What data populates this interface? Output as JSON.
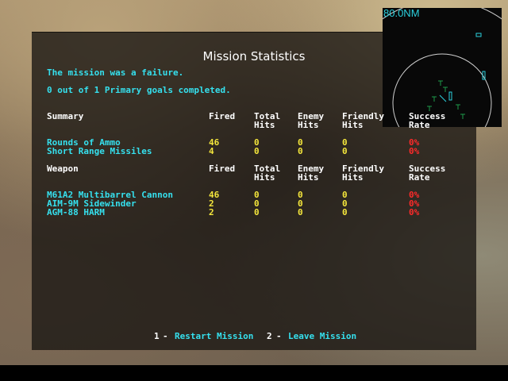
{
  "title": "Mission Statistics",
  "status_line": "The mission was a failure.",
  "goals_line": "0 out of 1 Primary goals completed.",
  "radar": {
    "range_label": "80.0NM"
  },
  "columns": {
    "fired": "Fired",
    "total_hits_1": "Total",
    "total_hits_2": "Hits",
    "enemy_hits_1": "Enemy",
    "enemy_hits_2": "Hits",
    "friendly_hits_1": "Friendly",
    "friendly_hits_2": "Hits",
    "success_1": "Success",
    "success_2": "Rate"
  },
  "summary": {
    "header": "Summary",
    "rows": [
      {
        "name": "Rounds of Ammo",
        "fired": "46",
        "total": "0",
        "enemy": "0",
        "friendly": "0",
        "rate": "0%"
      },
      {
        "name": "Short Range Missiles",
        "fired": "4",
        "total": "0",
        "enemy": "0",
        "friendly": "0",
        "rate": "0%"
      }
    ]
  },
  "weapons": {
    "header": "Weapon",
    "rows": [
      {
        "name": "M61A2 Multibarrel Cannon",
        "fired": "46",
        "total": "0",
        "enemy": "0",
        "friendly": "0",
        "rate": "0%"
      },
      {
        "name": "AIM-9M Sidewinder",
        "fired": "2",
        "total": "0",
        "enemy": "0",
        "friendly": "0",
        "rate": "0%"
      },
      {
        "name": "AGM-88 HARM",
        "fired": "2",
        "total": "0",
        "enemy": "0",
        "friendly": "0",
        "rate": "0%"
      }
    ]
  },
  "options": {
    "restart_key": "1",
    "restart_sep": "-",
    "restart_label": "Restart Mission",
    "leave_key": "2",
    "leave_sep": "-",
    "leave_label": "Leave Mission"
  },
  "colors": {
    "label": "#35e0ee",
    "header": "#ffffff",
    "value": "#f4e63c",
    "rate": "#ff2a2a"
  }
}
